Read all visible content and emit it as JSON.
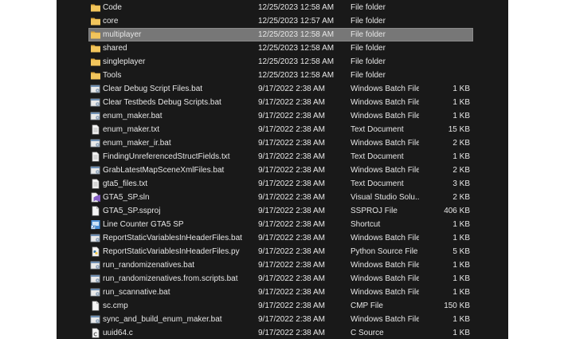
{
  "files": [
    {
      "name": "Code",
      "date": "12/25/2023 12:58 AM",
      "type": "File folder",
      "size": "",
      "icon": "folder-icon"
    },
    {
      "name": "core",
      "date": "12/25/2023 12:57 AM",
      "type": "File folder",
      "size": "",
      "icon": "folder-icon"
    },
    {
      "name": "multiplayer",
      "date": "12/25/2023 12:58 AM",
      "type": "File folder",
      "size": "",
      "icon": "folder-icon",
      "selected": true
    },
    {
      "name": "shared",
      "date": "12/25/2023 12:58 AM",
      "type": "File folder",
      "size": "",
      "icon": "folder-icon"
    },
    {
      "name": "singleplayer",
      "date": "12/25/2023 12:58 AM",
      "type": "File folder",
      "size": "",
      "icon": "folder-icon"
    },
    {
      "name": "Tools",
      "date": "12/25/2023 12:58 AM",
      "type": "File folder",
      "size": "",
      "icon": "folder-icon"
    },
    {
      "name": "Clear Debug Script Files.bat",
      "date": "9/17/2022 2:38 AM",
      "type": "Windows Batch File",
      "size": "1 KB",
      "icon": "batch-file-icon"
    },
    {
      "name": "Clear Testbeds Debug Scripts.bat",
      "date": "9/17/2022 2:38 AM",
      "type": "Windows Batch File",
      "size": "1 KB",
      "icon": "batch-file-icon"
    },
    {
      "name": "enum_maker.bat",
      "date": "9/17/2022 2:38 AM",
      "type": "Windows Batch File",
      "size": "1 KB",
      "icon": "batch-file-icon"
    },
    {
      "name": "enum_maker.txt",
      "date": "9/17/2022 2:38 AM",
      "type": "Text Document",
      "size": "15 KB",
      "icon": "text-file-icon"
    },
    {
      "name": "enum_maker_ir.bat",
      "date": "9/17/2022 2:38 AM",
      "type": "Windows Batch File",
      "size": "2 KB",
      "icon": "batch-file-icon"
    },
    {
      "name": "FindingUnreferencedStructFields.txt",
      "date": "9/17/2022 2:38 AM",
      "type": "Text Document",
      "size": "1 KB",
      "icon": "text-file-icon"
    },
    {
      "name": "GrabLatestMapSceneXmlFiles.bat",
      "date": "9/17/2022 2:38 AM",
      "type": "Windows Batch File",
      "size": "2 KB",
      "icon": "batch-file-icon"
    },
    {
      "name": "gta5_files.txt",
      "date": "9/17/2022 2:38 AM",
      "type": "Text Document",
      "size": "3 KB",
      "icon": "text-file-icon"
    },
    {
      "name": "GTA5_SP.sln",
      "date": "9/17/2022 2:38 AM",
      "type": "Visual Studio Solu...",
      "size": "2 KB",
      "icon": "visual-studio-solution-icon"
    },
    {
      "name": "GTA5_SP.ssproj",
      "date": "9/17/2022 2:38 AM",
      "type": "SSPROJ File",
      "size": "406 KB",
      "icon": "blank-file-icon"
    },
    {
      "name": "Line Counter GTA5 SP",
      "date": "9/17/2022 2:38 AM",
      "type": "Shortcut",
      "size": "1 KB",
      "icon": "shortcut-icon"
    },
    {
      "name": "ReportStaticVariablesInHeaderFiles.bat",
      "date": "9/17/2022 2:38 AM",
      "type": "Windows Batch File",
      "size": "1 KB",
      "icon": "batch-file-icon"
    },
    {
      "name": "ReportStaticVariablesInHeaderFiles.py",
      "date": "9/17/2022 2:38 AM",
      "type": "Python Source File",
      "size": "5 KB",
      "icon": "python-file-icon"
    },
    {
      "name": "run_randomizenatives.bat",
      "date": "9/17/2022 2:38 AM",
      "type": "Windows Batch File",
      "size": "1 KB",
      "icon": "batch-file-icon"
    },
    {
      "name": "run_randomizenatives.from.scripts.bat",
      "date": "9/17/2022 2:38 AM",
      "type": "Windows Batch File",
      "size": "1 KB",
      "icon": "batch-file-icon"
    },
    {
      "name": "run_scannative.bat",
      "date": "9/17/2022 2:38 AM",
      "type": "Windows Batch File",
      "size": "1 KB",
      "icon": "batch-file-icon"
    },
    {
      "name": "sc.cmp",
      "date": "9/17/2022 2:38 AM",
      "type": "CMP File",
      "size": "150 KB",
      "icon": "blank-file-icon"
    },
    {
      "name": "sync_and_build_enum_maker.bat",
      "date": "9/17/2022 2:38 AM",
      "type": "Windows Batch File",
      "size": "1 KB",
      "icon": "batch-file-icon"
    },
    {
      "name": "uuid64.c",
      "date": "9/17/2022 2:38 AM",
      "type": "C Source",
      "size": "1 KB",
      "icon": "c-source-file-icon"
    }
  ],
  "colors": {
    "background": "#191919",
    "text": "#e6e6e6",
    "selection": "#777777",
    "folder": "#f2c55c"
  }
}
